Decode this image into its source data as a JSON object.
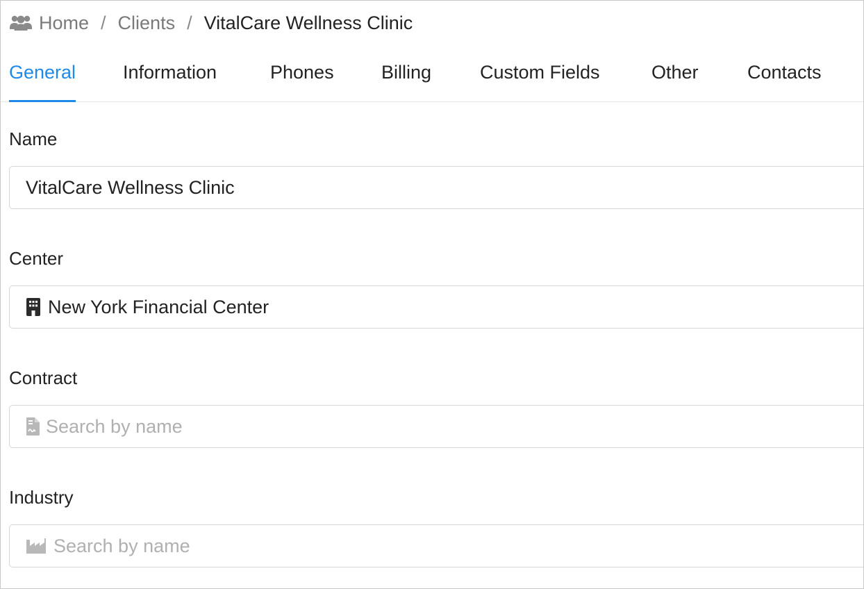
{
  "breadcrumb": {
    "icon": "users-icon",
    "items": [
      "Home",
      "Clients",
      "VitalCare Wellness Clinic"
    ],
    "separator": "/"
  },
  "tabs": [
    {
      "label": "General",
      "active": true
    },
    {
      "label": "Information",
      "active": false
    },
    {
      "label": "Phones",
      "active": false
    },
    {
      "label": "Billing",
      "active": false
    },
    {
      "label": "Custom Fields",
      "active": false
    },
    {
      "label": "Other",
      "active": false
    },
    {
      "label": "Contacts",
      "active": false
    }
  ],
  "accent_color": "#1e8ae8",
  "form": {
    "name": {
      "label": "Name",
      "value": "VitalCare Wellness Clinic"
    },
    "center": {
      "label": "Center",
      "value": "New York Financial Center",
      "icon": "building-icon"
    },
    "contract": {
      "label": "Contract",
      "placeholder": "Search by name",
      "icon": "contract-file-icon"
    },
    "industry": {
      "label": "Industry",
      "placeholder": "Search by name",
      "icon": "industry-icon"
    }
  }
}
